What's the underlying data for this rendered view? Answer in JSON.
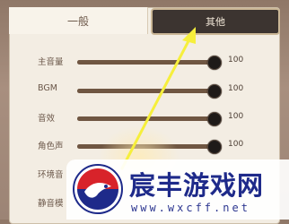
{
  "tabs": {
    "general": "一般",
    "other": "其他"
  },
  "settings": [
    {
      "label": "主音量",
      "value": 100,
      "level": 1.0
    },
    {
      "label": "BGM",
      "value": 100,
      "level": 1.0
    },
    {
      "label": "音效",
      "value": 100,
      "level": 1.0
    },
    {
      "label": "角色声",
      "value": 100,
      "level": 1.0
    },
    {
      "label": "环境音",
      "value": "",
      "level": null
    },
    {
      "label": "静音模",
      "value": "",
      "level": null
    }
  ],
  "watermark": {
    "brand": "宸丰游戏网",
    "url": "www.wxcff.net"
  },
  "colors": {
    "annotation_arrow": "#f6ef3c",
    "brand": "#1e2a8a",
    "active_tab": "#3c3430"
  }
}
